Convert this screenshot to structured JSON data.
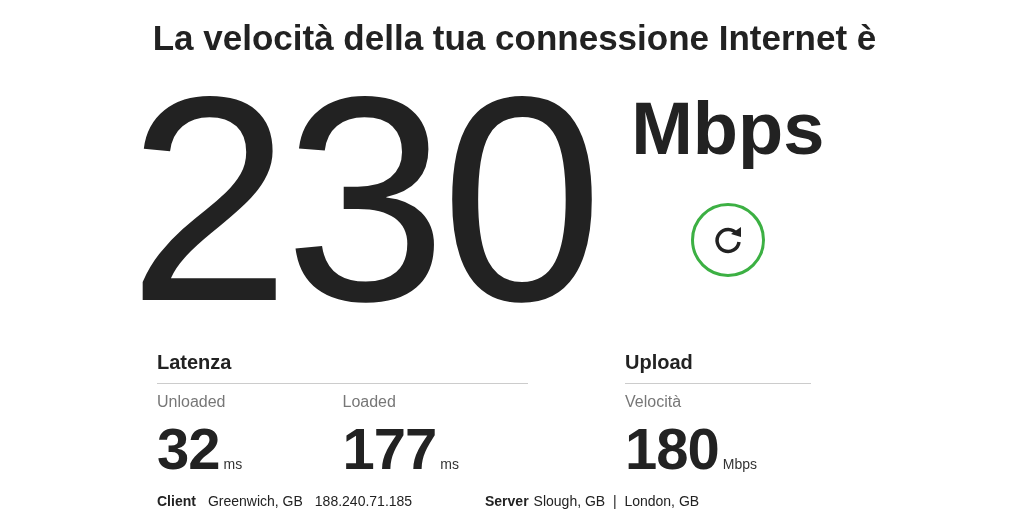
{
  "title": "La velocità della tua connessione Internet è",
  "speed": {
    "value": "230",
    "unit": "Mbps"
  },
  "sections": [
    {
      "title": "Latenza",
      "metrics": [
        {
          "label": "Unloaded",
          "value": "32",
          "unit": "ms"
        },
        {
          "label": "Loaded",
          "value": "177",
          "unit": "ms"
        }
      ]
    },
    {
      "title": "Upload",
      "metrics": [
        {
          "label": "Velocità",
          "value": "180",
          "unit": "Mbps"
        }
      ]
    }
  ],
  "client": {
    "label": "Client",
    "location": "Greenwich, GB",
    "ip": "188.240.71.185"
  },
  "server": {
    "label": "Server",
    "text": "Slough, GB  |  London, GB"
  }
}
